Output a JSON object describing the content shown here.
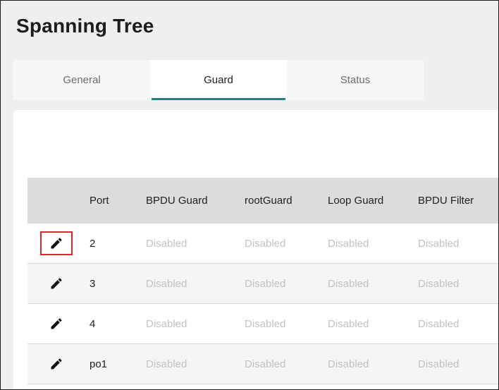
{
  "page": {
    "title": "Spanning Tree"
  },
  "tabs": [
    {
      "label": "General",
      "active": false
    },
    {
      "label": "Guard",
      "active": true
    },
    {
      "label": "Status",
      "active": false
    }
  ],
  "table": {
    "headers": {
      "port": "Port",
      "bpdu_guard": "BPDU Guard",
      "root_guard": "rootGuard",
      "loop_guard": "Loop Guard",
      "bpdu_filter": "BPDU Filter"
    },
    "rows": [
      {
        "port": "2",
        "bpdu_guard": "Disabled",
        "root_guard": "Disabled",
        "loop_guard": "Disabled",
        "bpdu_filter": "Disabled",
        "edit_icon": "pencil-icon",
        "highlighted": true
      },
      {
        "port": "3",
        "bpdu_guard": "Disabled",
        "root_guard": "Disabled",
        "loop_guard": "Disabled",
        "bpdu_filter": "Disabled",
        "edit_icon": "pencil-icon",
        "highlighted": false
      },
      {
        "port": "4",
        "bpdu_guard": "Disabled",
        "root_guard": "Disabled",
        "loop_guard": "Disabled",
        "bpdu_filter": "Disabled",
        "edit_icon": "pencil-icon",
        "highlighted": false
      },
      {
        "port": "po1",
        "bpdu_guard": "Disabled",
        "root_guard": "Disabled",
        "loop_guard": "Disabled",
        "bpdu_filter": "Disabled",
        "edit_icon": "pencil-icon",
        "highlighted": false
      }
    ]
  },
  "colors": {
    "accent": "#0e8a82",
    "highlight_border": "#e0262c",
    "muted_text": "#c2c2c2"
  }
}
